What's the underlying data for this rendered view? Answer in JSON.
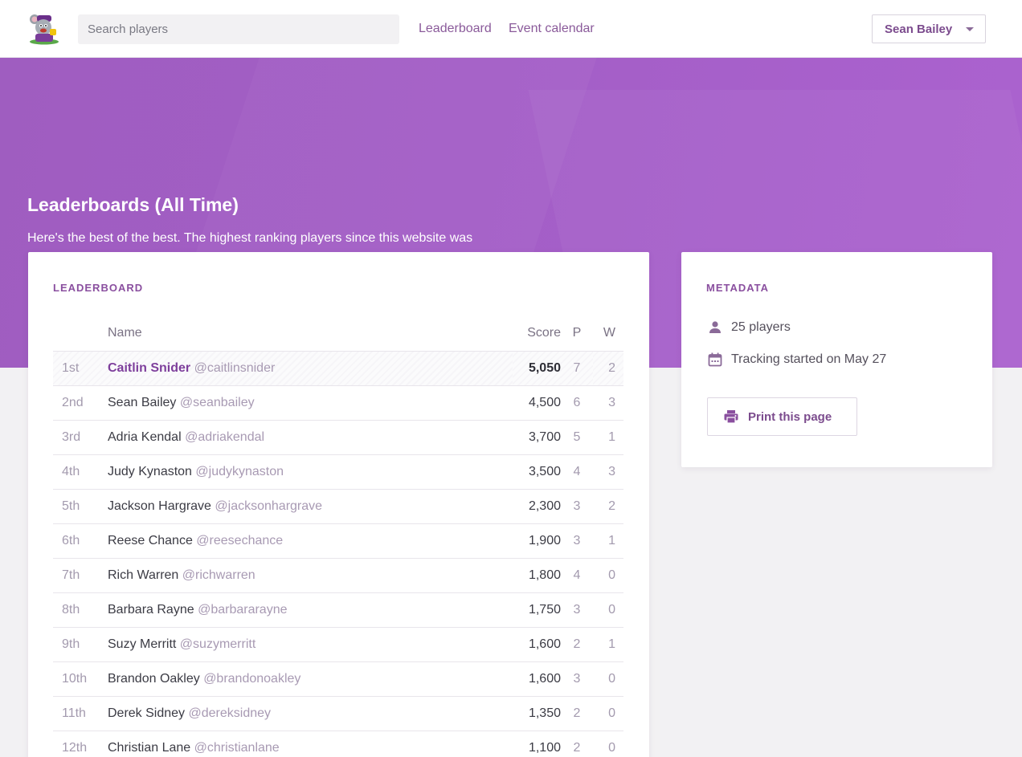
{
  "header": {
    "search_placeholder": "Search players",
    "nav": {
      "leaderboard": "Leaderboard",
      "event_calendar": "Event calendar"
    },
    "user": "Sean Bailey"
  },
  "hero": {
    "title": "Leaderboards (All Time)",
    "subtitle": "Here's the best of the best. The highest ranking players since this website was built."
  },
  "leaderboard": {
    "heading": "LEADERBOARD",
    "columns": {
      "name": "Name",
      "score": "Score",
      "p": "P",
      "w": "W"
    },
    "rows": [
      {
        "rank": "1st",
        "name": "Caitlin Snider",
        "handle": "@caitlinsnider",
        "score": "5,050",
        "p": "7",
        "w": "2"
      },
      {
        "rank": "2nd",
        "name": "Sean Bailey",
        "handle": "@seanbailey",
        "score": "4,500",
        "p": "6",
        "w": "3"
      },
      {
        "rank": "3rd",
        "name": "Adria Kendal",
        "handle": "@adriakendal",
        "score": "3,700",
        "p": "5",
        "w": "1"
      },
      {
        "rank": "4th",
        "name": "Judy Kynaston",
        "handle": "@judykynaston",
        "score": "3,500",
        "p": "4",
        "w": "3"
      },
      {
        "rank": "5th",
        "name": "Jackson Hargrave",
        "handle": "@jacksonhargrave",
        "score": "2,300",
        "p": "3",
        "w": "2"
      },
      {
        "rank": "6th",
        "name": "Reese Chance",
        "handle": "@reesechance",
        "score": "1,900",
        "p": "3",
        "w": "1"
      },
      {
        "rank": "7th",
        "name": "Rich Warren",
        "handle": "@richwarren",
        "score": "1,800",
        "p": "4",
        "w": "0"
      },
      {
        "rank": "8th",
        "name": "Barbara Rayne",
        "handle": "@barbararayne",
        "score": "1,750",
        "p": "3",
        "w": "0"
      },
      {
        "rank": "9th",
        "name": "Suzy Merritt",
        "handle": "@suzymerritt",
        "score": "1,600",
        "p": "2",
        "w": "1"
      },
      {
        "rank": "10th",
        "name": "Brandon Oakley",
        "handle": "@brandonoakley",
        "score": "1,600",
        "p": "3",
        "w": "0"
      },
      {
        "rank": "11th",
        "name": "Derek Sidney",
        "handle": "@dereksidney",
        "score": "1,350",
        "p": "2",
        "w": "0"
      },
      {
        "rank": "12th",
        "name": "Christian Lane",
        "handle": "@christianlane",
        "score": "1,100",
        "p": "2",
        "w": "0"
      }
    ]
  },
  "metadata": {
    "heading": "METADATA",
    "players": "25 players",
    "tracking": "Tracking started on May 27",
    "print_label": "Print this page"
  },
  "icons": {
    "logo": "mascot-logo",
    "players": "person-icon",
    "tracking": "calendar-icon",
    "print": "printer-icon",
    "dropdown": "caret-down-icon"
  },
  "colors": {
    "brand": "#a35ec6",
    "accent": "#7e3f9c"
  }
}
